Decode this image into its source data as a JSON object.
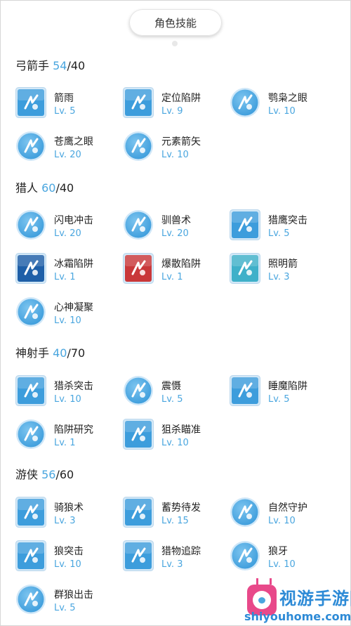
{
  "header": {
    "title": "角色技能"
  },
  "sections": [
    {
      "name": "弓箭手",
      "current": "54",
      "max": "/40",
      "skills": [
        {
          "name": "箭雨",
          "level": "Lv. 5",
          "icon": "arrow-rain-icon",
          "style": "square"
        },
        {
          "name": "定位陷阱",
          "level": "Lv. 9",
          "icon": "locate-trap-icon",
          "style": "square"
        },
        {
          "name": "鹗枭之眼",
          "level": "Lv. 10",
          "icon": "owl-eye-icon",
          "style": "round"
        },
        {
          "name": "苍鹰之眼",
          "level": "Lv. 20",
          "icon": "hawk-eye-icon",
          "style": "round"
        },
        {
          "name": "元素箭矢",
          "level": "Lv. 10",
          "icon": "element-arrow-icon",
          "style": "round"
        }
      ]
    },
    {
      "name": "猎人",
      "current": "60",
      "max": "/40",
      "skills": [
        {
          "name": "闪电冲击",
          "level": "Lv. 20",
          "icon": "lightning-strike-icon",
          "style": "round"
        },
        {
          "name": "驯兽术",
          "level": "Lv. 20",
          "icon": "beast-taming-icon",
          "style": "round"
        },
        {
          "name": "猎鹰突击",
          "level": "Lv. 5",
          "icon": "falcon-assault-icon",
          "style": "square"
        },
        {
          "name": "冰霜陷阱",
          "level": "Lv. 1",
          "icon": "frost-trap-icon",
          "style": "square-dark"
        },
        {
          "name": "爆散陷阱",
          "level": "Lv. 1",
          "icon": "explosive-trap-icon",
          "style": "square-red"
        },
        {
          "name": "照明箭",
          "level": "Lv. 3",
          "icon": "flare-arrow-icon",
          "style": "square-teal"
        },
        {
          "name": "心神凝聚",
          "level": "Lv. 10",
          "icon": "focus-mind-icon",
          "style": "round"
        }
      ]
    },
    {
      "name": "神射手",
      "current": "40",
      "max": "/70",
      "skills": [
        {
          "name": "猎杀突击",
          "level": "Lv. 10",
          "icon": "hunt-assault-icon",
          "style": "square"
        },
        {
          "name": "震慑",
          "level": "Lv. 5",
          "icon": "intimidate-icon",
          "style": "round"
        },
        {
          "name": "睡魔陷阱",
          "level": "Lv. 5",
          "icon": "sleep-trap-icon",
          "style": "square"
        },
        {
          "name": "陷阱研究",
          "level": "Lv. 1",
          "icon": "trap-research-icon",
          "style": "round"
        },
        {
          "name": "狙杀瞄准",
          "level": "Lv. 10",
          "icon": "sniper-aim-icon",
          "style": "square"
        }
      ]
    },
    {
      "name": "游侠",
      "current": "56",
      "max": "/60",
      "skills": [
        {
          "name": "骑狼术",
          "level": "Lv. 3",
          "icon": "wolf-riding-icon",
          "style": "square"
        },
        {
          "name": "蓄势待发",
          "level": "Lv. 15",
          "icon": "charge-up-icon",
          "style": "square"
        },
        {
          "name": "自然守护",
          "level": "Lv. 10",
          "icon": "nature-guard-icon",
          "style": "round"
        },
        {
          "name": "狼突击",
          "level": "Lv. 10",
          "icon": "wolf-assault-icon",
          "style": "square"
        },
        {
          "name": "猎物追踪",
          "level": "Lv. 3",
          "icon": "prey-tracking-icon",
          "style": "square"
        },
        {
          "name": "狼牙",
          "level": "Lv. 10",
          "icon": "wolf-fang-icon",
          "style": "round"
        },
        {
          "name": "群狼出击",
          "level": "Lv. 5",
          "icon": "wolf-pack-icon",
          "style": "round"
        }
      ]
    }
  ],
  "watermark": {
    "text_cn": "视游手游网",
    "url": "shiyouhome.com"
  },
  "colors": {
    "accent": "#4aa6df",
    "icon_blue": "#3d9ddc",
    "icon_red": "#c9383a",
    "icon_dark": "#1e5fa8"
  }
}
